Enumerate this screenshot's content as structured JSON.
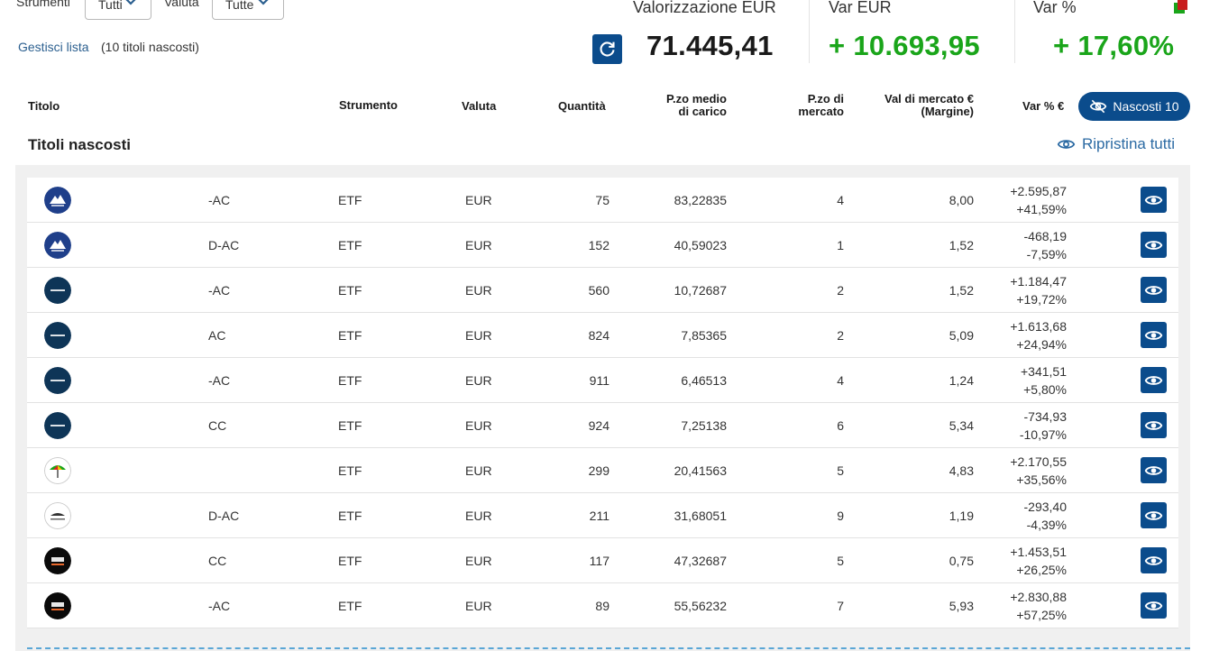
{
  "filters": {
    "strumenti_label": "Strumenti",
    "strumenti_value": "Tutti",
    "valuta_label": "Valuta",
    "valuta_value": "Tutte"
  },
  "manage": {
    "link": "Gestisci lista",
    "hidden_note": "(10 titoli nascosti)"
  },
  "summary": {
    "valorizzazione_label": "Valorizzazione EUR",
    "valorizzazione_value": "71.445,41",
    "var_eur_label": "Var EUR",
    "var_eur_value": "+ 10.693,95",
    "var_pct_label": "Var %",
    "var_pct_value": "+ 17,60%"
  },
  "columns": {
    "titolo": "Titolo",
    "strumento": "Strumento",
    "valuta": "Valuta",
    "quantita": "Quantità",
    "pzo_medio_1": "P.zo medio",
    "pzo_medio_2": "di carico",
    "pzo_mercato_1": "P.zo di",
    "pzo_mercato_2": "mercato",
    "val_mercato_1": "Val di mercato €",
    "val_mercato_2": "(Margine)",
    "var_pct": "Var % €"
  },
  "nascosti_button": "Nascosti 10",
  "section": {
    "title": "Titoli nascosti",
    "restore": "Ripristina tutti"
  },
  "colors": {
    "primary": "#0b4c8c",
    "positive": "#1aa51a",
    "link": "#2b6aa3"
  },
  "rows": [
    {
      "logo": "invesco",
      "name_frag": "-AC",
      "strumento": "ETF",
      "valuta": "EUR",
      "quantita": "75",
      "pzo_medio": "83,22835",
      "pzo_mercato_frag": "4",
      "val_frag": "8,00",
      "var_abs": "+2.595,87",
      "var_pct": "+41,59%"
    },
    {
      "logo": "invesco",
      "name_frag": "D-AC",
      "strumento": "ETF",
      "valuta": "EUR",
      "quantita": "152",
      "pzo_medio": "40,59023",
      "pzo_mercato_frag": "1",
      "val_frag": "1,52",
      "var_abs": "-468,19",
      "var_pct": "-7,59%"
    },
    {
      "logo": "blackrock",
      "name_frag": "-AC",
      "strumento": "ETF",
      "valuta": "EUR",
      "quantita": "560",
      "pzo_medio": "10,72687",
      "pzo_mercato_frag": "2",
      "val_frag": "1,52",
      "var_abs": "+1.184,47",
      "var_pct": "+19,72%"
    },
    {
      "logo": "blackrock",
      "name_frag": "AC",
      "strumento": "ETF",
      "valuta": "EUR",
      "quantita": "824",
      "pzo_medio": "7,85365",
      "pzo_mercato_frag": "2",
      "val_frag": "5,09",
      "var_abs": "+1.613,68",
      "var_pct": "+24,94%"
    },
    {
      "logo": "blackrock",
      "name_frag": "-AC",
      "strumento": "ETF",
      "valuta": "EUR",
      "quantita": "911",
      "pzo_medio": "6,46513",
      "pzo_mercato_frag": "4",
      "val_frag": "1,24",
      "var_abs": "+341,51",
      "var_pct": "+5,80%"
    },
    {
      "logo": "blackrock",
      "name_frag": "CC",
      "strumento": "ETF",
      "valuta": "EUR",
      "quantita": "924",
      "pzo_medio": "7,25138",
      "pzo_mercato_frag": "6",
      "val_frag": "5,34",
      "var_abs": "-734,93",
      "var_pct": "-10,97%"
    },
    {
      "logo": "umbrella",
      "name_frag": "",
      "strumento": "ETF",
      "valuta": "EUR",
      "quantita": "299",
      "pzo_medio": "20,41563",
      "pzo_mercato_frag": "5",
      "val_frag": "4,83",
      "var_abs": "+2.170,55",
      "var_pct": "+35,56%"
    },
    {
      "logo": "wisdomtree",
      "name_frag": "D-AC",
      "strumento": "ETF",
      "valuta": "EUR",
      "quantita": "211",
      "pzo_medio": "31,68051",
      "pzo_mercato_frag": "9",
      "val_frag": "1,19",
      "var_abs": "-293,40",
      "var_pct": "-4,39%"
    },
    {
      "logo": "dws",
      "name_frag": "CC",
      "strumento": "ETF",
      "valuta": "EUR",
      "quantita": "117",
      "pzo_medio": "47,32687",
      "pzo_mercato_frag": "5",
      "val_frag": "0,75",
      "var_abs": "+1.453,51",
      "var_pct": "+26,25%"
    },
    {
      "logo": "dws",
      "name_frag": "-AC",
      "strumento": "ETF",
      "valuta": "EUR",
      "quantita": "89",
      "pzo_medio": "55,56232",
      "pzo_mercato_frag": "7",
      "val_frag": "5,93",
      "var_abs": "+2.830,88",
      "var_pct": "+57,25%"
    }
  ]
}
